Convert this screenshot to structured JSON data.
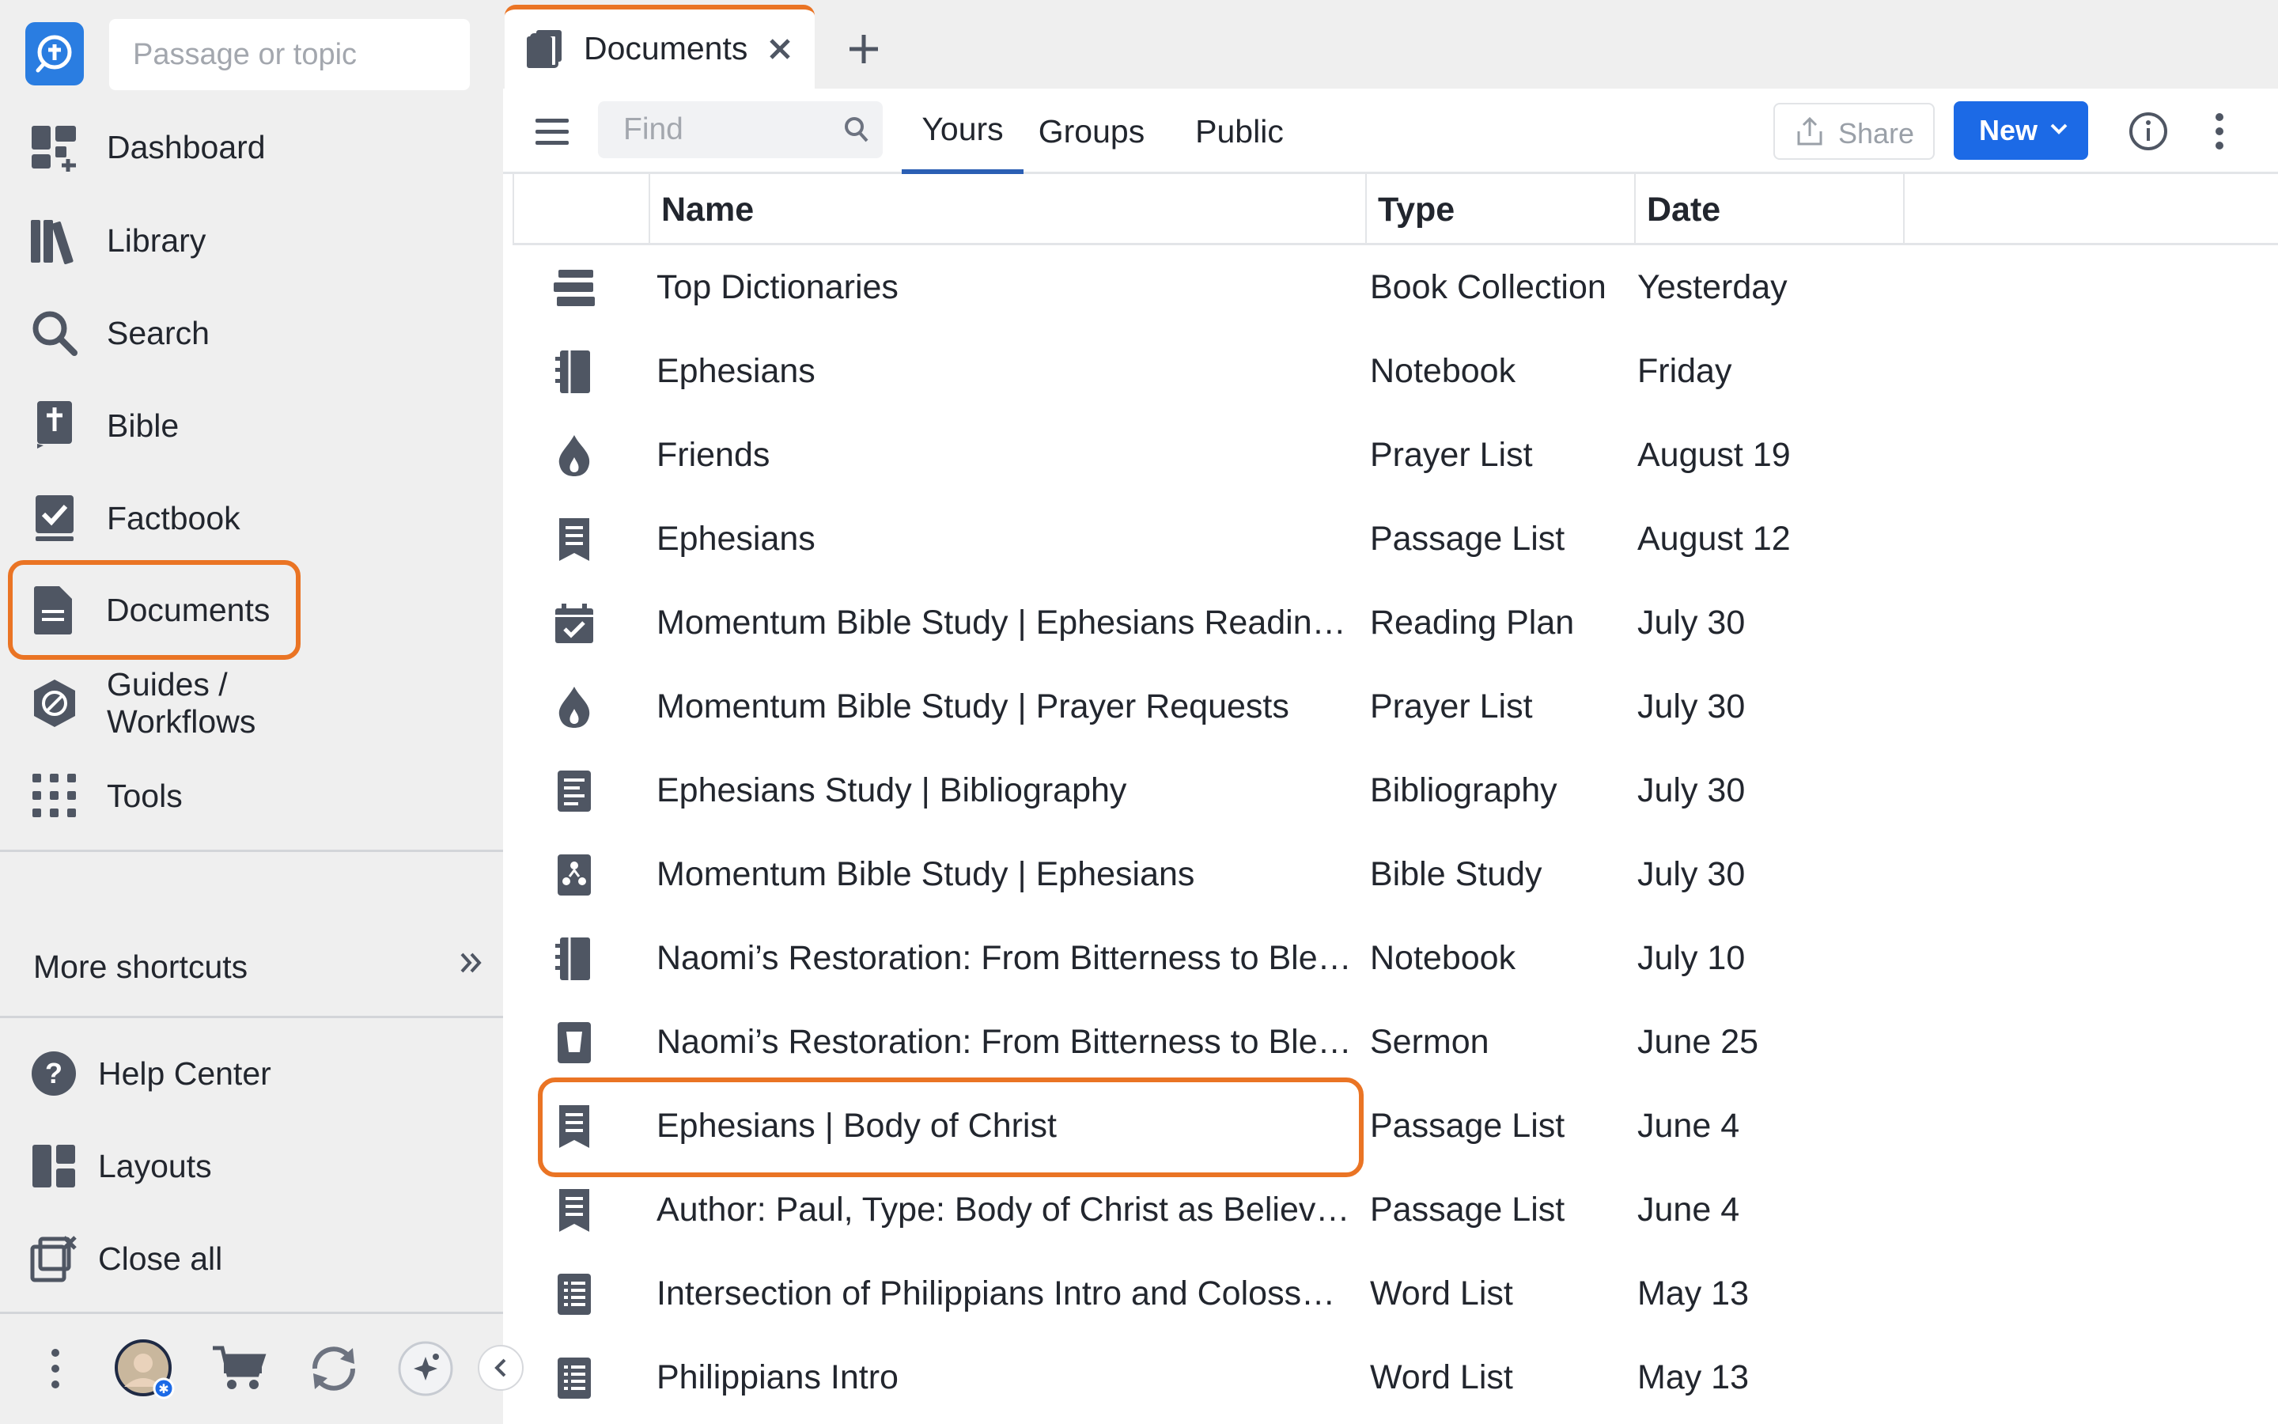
{
  "sidebar": {
    "search_placeholder": "Passage or topic",
    "nav": [
      {
        "label": "Dashboard",
        "icon": "dashboard-icon"
      },
      {
        "label": "Library",
        "icon": "library-icon"
      },
      {
        "label": "Search",
        "icon": "search-icon"
      },
      {
        "label": "Bible",
        "icon": "bible-icon"
      },
      {
        "label": "Factbook",
        "icon": "factbook-icon"
      },
      {
        "label": "Documents",
        "icon": "documents-icon",
        "highlighted": true
      },
      {
        "label": "Guides / Workflows",
        "icon": "guides-icon"
      },
      {
        "label": "Tools",
        "icon": "tools-grid-icon"
      }
    ],
    "more_shortcuts": "More shortcuts",
    "bottom": [
      {
        "label": "Help Center",
        "icon": "help-icon"
      },
      {
        "label": "Layouts",
        "icon": "layouts-icon"
      },
      {
        "label": "Close all",
        "icon": "close-all-icon"
      }
    ]
  },
  "tabs": [
    {
      "label": "Documents",
      "icon": "documents-tab-icon",
      "active": true
    }
  ],
  "toolbar": {
    "find_placeholder": "Find",
    "segments": [
      "Yours",
      "Groups",
      "Public"
    ],
    "active_segment": "Yours",
    "share_label": "Share",
    "new_label": "New"
  },
  "table": {
    "columns": [
      "Name",
      "Type",
      "Date"
    ],
    "rows": [
      {
        "name": "Top Dictionaries",
        "type": "Book Collection",
        "date": "Yesterday",
        "icon": "book-collection-icon"
      },
      {
        "name": "Ephesians",
        "type": "Notebook",
        "date": "Friday",
        "icon": "notebook-icon"
      },
      {
        "name": "Friends",
        "type": "Prayer List",
        "date": "August 19",
        "icon": "prayer-list-icon"
      },
      {
        "name": "Ephesians",
        "type": "Passage List",
        "date": "August 12",
        "icon": "passage-list-icon"
      },
      {
        "name": "Momentum Bible Study | Ephesians Readin…",
        "type": "Reading Plan",
        "date": "July 30",
        "icon": "reading-plan-icon"
      },
      {
        "name": "Momentum Bible Study | Prayer Requests",
        "type": "Prayer List",
        "date": "July 30",
        "icon": "prayer-list-icon"
      },
      {
        "name": "Ephesians Study | Bibliography",
        "type": "Bibliography",
        "date": "July 30",
        "icon": "bibliography-icon"
      },
      {
        "name": "Momentum Bible Study | Ephesians",
        "type": "Bible Study",
        "date": "July 30",
        "icon": "bible-study-icon"
      },
      {
        "name": "Naomi’s Restoration: From Bitterness to Ble…",
        "type": "Notebook",
        "date": "July 10",
        "icon": "notebook-icon"
      },
      {
        "name": "Naomi’s Restoration: From Bitterness to Ble…",
        "type": "Sermon",
        "date": "June 25",
        "icon": "sermon-icon",
        "highlighted": true
      },
      {
        "name": "Ephesians | Body of Christ",
        "type": "Passage List",
        "date": "June 4",
        "icon": "passage-list-icon"
      },
      {
        "name": "Author: Paul, Type: Body of Christ as Believ…",
        "type": "Passage List",
        "date": "June 4",
        "icon": "passage-list-icon"
      },
      {
        "name": "Intersection of Philippians Intro and Coloss…",
        "type": "Word List",
        "date": "May 13",
        "icon": "word-list-icon"
      },
      {
        "name": "Philippians Intro",
        "type": "Word List",
        "date": "May 13",
        "icon": "word-list-icon"
      }
    ]
  },
  "colors": {
    "accent_orange": "#ea7424",
    "primary_blue": "#1c6ae6",
    "icon_gray": "#4f5663",
    "sidebar_bg": "#efefef"
  }
}
